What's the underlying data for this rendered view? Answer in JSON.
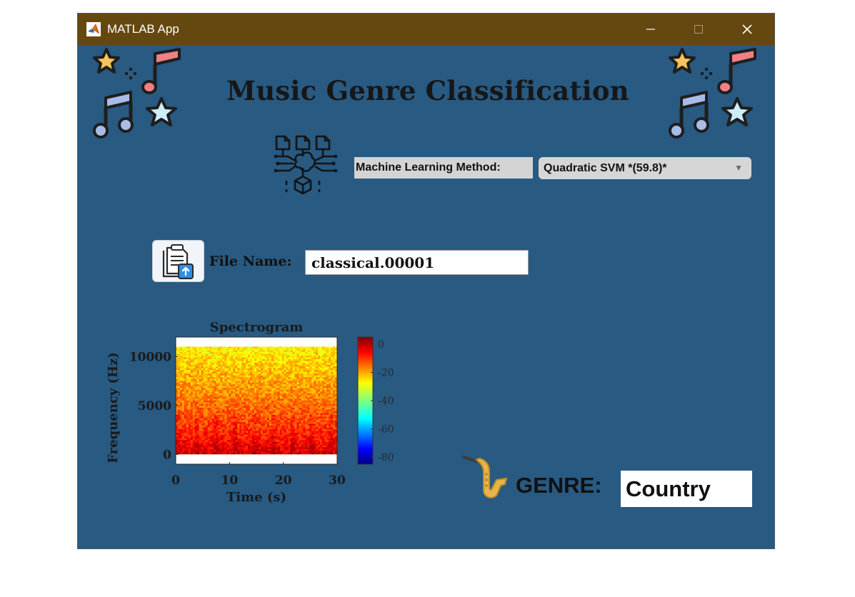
{
  "window": {
    "title": "MATLAB App",
    "controls": {
      "minimize": "—",
      "maximize": "☐",
      "close": "✕"
    },
    "background_color": "#285a82",
    "titlebar_color": "#654710"
  },
  "app": {
    "title": "Music Genre Classification"
  },
  "method": {
    "label": "Machine Learning Method:",
    "selected": "Quadratic SVM *(59.8)*",
    "icon": "ai-network-icon"
  },
  "file": {
    "label": "File Name:",
    "value": "classical.00001",
    "button_icon": "file-upload-icon"
  },
  "genre": {
    "label": "GENRE:",
    "value": "Country",
    "icon": "saxophone-icon"
  },
  "decorations": {
    "icons": [
      "star-icon",
      "music-note-icon",
      "sparkle-icon"
    ]
  },
  "chart_data": {
    "type": "heatmap",
    "title": "Spectrogram",
    "xlabel": "Time (s)",
    "ylabel": "Frequency (Hz)",
    "xlim": [
      0,
      30
    ],
    "ylim": [
      -1000,
      12000
    ],
    "x_ticks": [
      "0",
      "10",
      "20",
      "30"
    ],
    "y_ticks": [
      "0",
      "5000",
      "10000"
    ],
    "x_tick_values": [
      0,
      10,
      20,
      30
    ],
    "y_tick_values": [
      0,
      5000,
      10000
    ],
    "data_extent": {
      "time": [
        0,
        30
      ],
      "frequency": [
        0,
        11025
      ]
    },
    "colorbar": {
      "ticks": [
        "0",
        "-20",
        "-40",
        "-60",
        "-80"
      ],
      "tick_values": [
        0,
        -20,
        -40,
        -60,
        -80
      ],
      "range": [
        -85,
        5
      ],
      "colormap": "jet"
    },
    "description": "Power concentrated near 0 dB at low frequencies (red), falling to about -25 dB (yellow/green) toward 11 kHz",
    "freq_profile": [
      {
        "f": 0,
        "db": -2
      },
      {
        "f": 1000,
        "db": -6
      },
      {
        "f": 3000,
        "db": -12
      },
      {
        "f": 5000,
        "db": -16
      },
      {
        "f": 7000,
        "db": -20
      },
      {
        "f": 9000,
        "db": -24
      },
      {
        "f": 11025,
        "db": -28
      }
    ]
  }
}
